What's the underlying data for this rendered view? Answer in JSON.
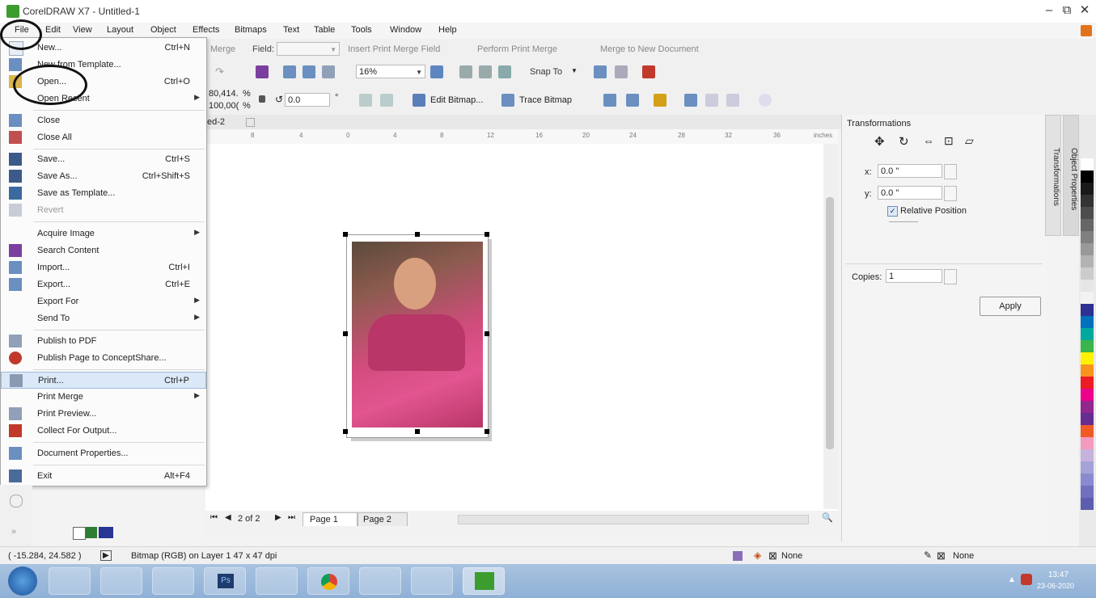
{
  "window": {
    "title": "CorelDRAW X7 - Untitled-1",
    "minimize": "–",
    "restore": "⧉",
    "close": "✕"
  },
  "menubar": [
    "File",
    "Edit",
    "View",
    "Layout",
    "Object",
    "Effects",
    "Bitmaps",
    "Text",
    "Table",
    "Tools",
    "Window",
    "Help"
  ],
  "toolbar1": {
    "merge": "Merge",
    "field_label": "Field:",
    "insert_merge_field": "Insert Print Merge Field",
    "perform_print_merge": "Perform Print Merge",
    "merge_new_document": "Merge to New Document"
  },
  "toolbar2": {
    "zoom": "16%",
    "snap_to": "Snap To"
  },
  "propertybar": {
    "scale_x": "80,414.",
    "scale_y": "100,00(",
    "percent": "%",
    "rotation": "0.0",
    "degree": "°",
    "edit_bitmap": "Edit Bitmap...",
    "trace_bitmap": "Trace Bitmap"
  },
  "doc_tab": "ed-2",
  "ruler_units": "inches",
  "ruler_numbers": [
    "8",
    "4",
    "0",
    "4",
    "8",
    "12",
    "16",
    "20",
    "24",
    "28",
    "32",
    "36"
  ],
  "file_menu": [
    {
      "label": "New...",
      "shortcut": "Ctrl+N"
    },
    {
      "label": "New from Template...",
      "shortcut": ""
    },
    {
      "label": "Open...",
      "shortcut": "Ctrl+O"
    },
    {
      "label": "Open Recent",
      "shortcut": "",
      "submenu": true
    },
    {
      "label": "Close",
      "shortcut": ""
    },
    {
      "label": "Close All",
      "shortcut": ""
    },
    {
      "label": "Save...",
      "shortcut": "Ctrl+S"
    },
    {
      "label": "Save As...",
      "shortcut": "Ctrl+Shift+S"
    },
    {
      "label": "Save as Template...",
      "shortcut": ""
    },
    {
      "label": "Revert",
      "shortcut": "",
      "disabled": true
    },
    {
      "label": "Acquire Image",
      "shortcut": "",
      "submenu": true
    },
    {
      "label": "Search Content",
      "shortcut": ""
    },
    {
      "label": "Import...",
      "shortcut": "Ctrl+I"
    },
    {
      "label": "Export...",
      "shortcut": "Ctrl+E"
    },
    {
      "label": "Export For",
      "shortcut": "",
      "submenu": true
    },
    {
      "label": "Send To",
      "shortcut": "",
      "submenu": true
    },
    {
      "label": "Publish to PDF",
      "shortcut": ""
    },
    {
      "label": "Publish Page to ConceptShare...",
      "shortcut": ""
    },
    {
      "label": "Print...",
      "shortcut": "Ctrl+P"
    },
    {
      "label": "Print Merge",
      "shortcut": "",
      "submenu": true
    },
    {
      "label": "Print Preview...",
      "shortcut": ""
    },
    {
      "label": "Collect For Output...",
      "shortcut": ""
    },
    {
      "label": "Document Properties...",
      "shortcut": ""
    },
    {
      "label": "Exit",
      "shortcut": "Alt+F4"
    }
  ],
  "pages": {
    "counter": "2 of 2",
    "page1": "Page 1",
    "page2": "Page 2"
  },
  "transformations": {
    "title": "Transformations",
    "x_label": "x:",
    "x_value": "0.0 \"",
    "y_label": "y:",
    "y_value": "0.0 \"",
    "relative_position": "Relative Position",
    "copies_label": "Copies:",
    "copies_value": "1",
    "apply": "Apply",
    "side_tab1": "Transformations",
    "side_tab2": "Object Properties"
  },
  "status": {
    "coords": "( -15.284, 24.582 )",
    "info": "Bitmap (RGB) on Layer 1 47 x 47 dpi",
    "fill_none": "None",
    "outline_none": "None"
  },
  "taskbar": {
    "time": "13:47",
    "date": "23-06-2020"
  },
  "palette": [
    "#ffffff",
    "#000000",
    "#1a1a1a",
    "#333333",
    "#4d4d4d",
    "#666666",
    "#808080",
    "#999999",
    "#b3b3b3",
    "#cccccc",
    "#e6e6e6",
    "#f2f2f2",
    "#2e3192",
    "#0071bc",
    "#00a99d",
    "#39b54a",
    "#fff200",
    "#f7941d",
    "#ed1c24",
    "#ec008c",
    "#92278f",
    "#662d91",
    "#f15a24",
    "#f49ac1",
    "#c7b2de",
    "#a3a3d8",
    "#8a8ad0",
    "#7070c0",
    "#5d5db0"
  ]
}
